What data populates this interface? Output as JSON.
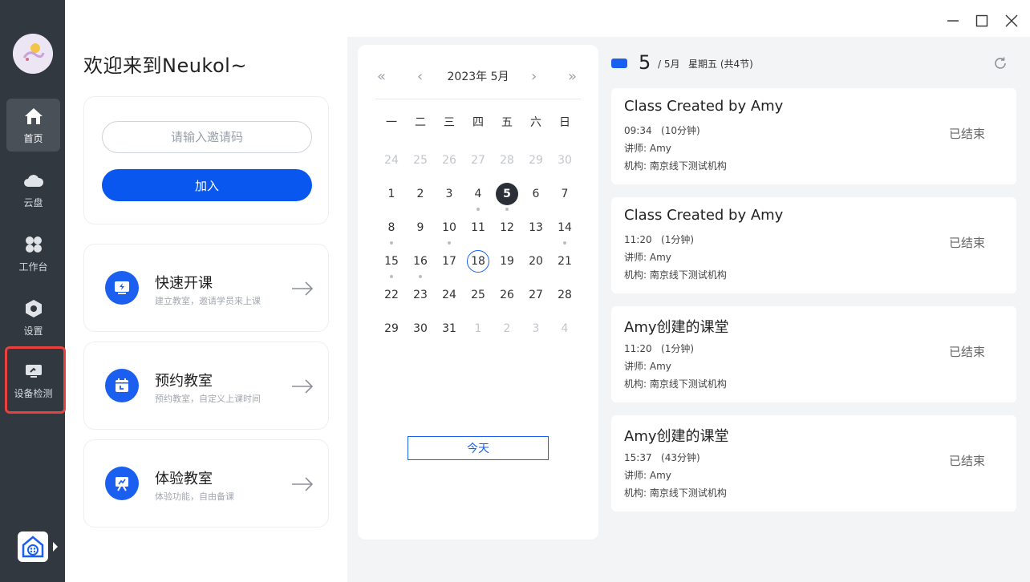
{
  "sidebar": {
    "items": [
      {
        "label": "首页",
        "icon": "home-icon",
        "active": true
      },
      {
        "label": "云盘",
        "icon": "cloud-icon",
        "active": false
      },
      {
        "label": "工作台",
        "icon": "workbench-icon",
        "active": false
      },
      {
        "label": "设置",
        "icon": "settings-icon",
        "active": false
      },
      {
        "label": "设备检测",
        "icon": "device-check-icon",
        "active": false
      }
    ]
  },
  "welcome": "欢迎来到Neukol~",
  "invite": {
    "placeholder": "请输入邀请码",
    "join_label": "加入"
  },
  "actions": [
    {
      "title": "快速开课",
      "subtitle": "建立教室，邀请学员来上课",
      "icon": "lightning-screen-icon"
    },
    {
      "title": "预约教室",
      "subtitle": "预约教室，自定义上课时间",
      "icon": "calendar-icon"
    },
    {
      "title": "体验教室",
      "subtitle": "体验功能，自由备课",
      "icon": "easel-icon"
    }
  ],
  "calendar": {
    "title": "2023年 5月",
    "prev_year": "«",
    "prev_month": "‹",
    "next_month": "›",
    "next_year": "»",
    "weekdays": [
      "一",
      "二",
      "三",
      "四",
      "五",
      "六",
      "日"
    ],
    "weeks": [
      [
        "24",
        "25",
        "26",
        "27",
        "28",
        "29",
        "30"
      ],
      [
        "1",
        "2",
        "3",
        "4",
        "5",
        "6",
        "7"
      ],
      [
        "8",
        "9",
        "10",
        "11",
        "12",
        "13",
        "14"
      ],
      [
        "15",
        "16",
        "17",
        "18",
        "19",
        "20",
        "21"
      ],
      [
        "22",
        "23",
        "24",
        "25",
        "26",
        "27",
        "28"
      ],
      [
        "29",
        "30",
        "31",
        "1",
        "2",
        "3",
        "4"
      ]
    ],
    "today_label": "今天"
  },
  "schedule": {
    "day": "5",
    "month": "/ 5月",
    "weekday": "星期五 (共4节)",
    "classes": [
      {
        "title": "Class Created by Amy",
        "time": "09:34",
        "duration": "(10分钟)",
        "teacher": "讲师: Amy",
        "org": "机构: 南京线下测试机构",
        "status": "已结束"
      },
      {
        "title": "Class Created by Amy",
        "time": "11:20",
        "duration": "(1分钟)",
        "teacher": "讲师: Amy",
        "org": "机构: 南京线下测试机构",
        "status": "已结束"
      },
      {
        "title": "Amy创建的课堂",
        "time": "11:20",
        "duration": "(1分钟)",
        "teacher": "讲师: Amy",
        "org": "机构: 南京线下测试机构",
        "status": "已结束"
      },
      {
        "title": "Amy创建的课堂",
        "time": "15:37",
        "duration": "(43分钟)",
        "teacher": "讲师: Amy",
        "org": "机构: 南京线下测试机构",
        "status": "已结束"
      }
    ]
  },
  "colors": {
    "accent": "#0a57f0",
    "sidebar": "#323840",
    "highlight": "#e8413e"
  }
}
